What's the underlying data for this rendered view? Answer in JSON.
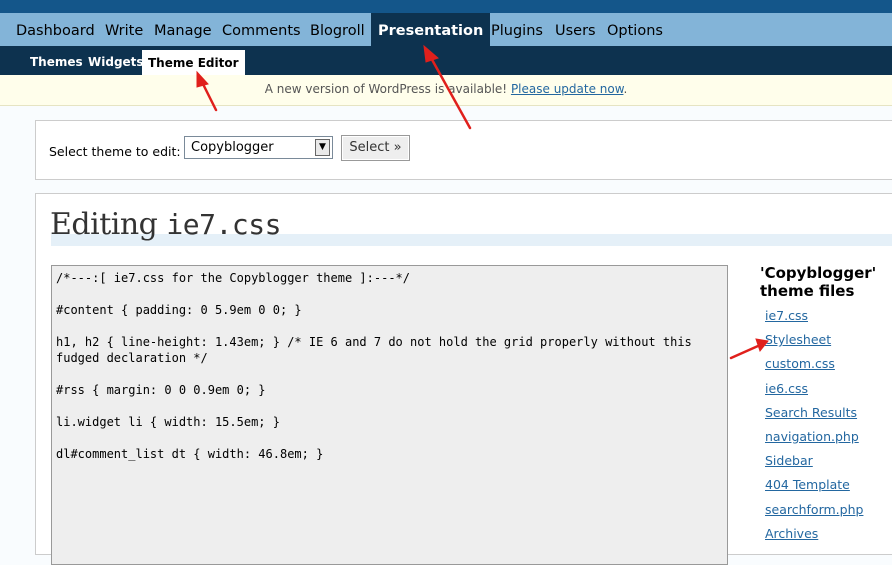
{
  "main_nav": [
    {
      "label": "Dashboard"
    },
    {
      "label": "Write"
    },
    {
      "label": "Manage"
    },
    {
      "label": "Comments"
    },
    {
      "label": "Blogroll"
    },
    {
      "label": "Presentation",
      "active": true
    },
    {
      "label": "Plugins"
    },
    {
      "label": "Users"
    },
    {
      "label": "Options"
    }
  ],
  "sub_nav": [
    {
      "label": "Themes"
    },
    {
      "label": "Widgets"
    },
    {
      "label": "Theme Editor",
      "active": true
    }
  ],
  "notice": {
    "text": "A new version of WordPress is available! ",
    "link": "Please update now",
    "end": "."
  },
  "theme_select": {
    "label": "Select theme to edit:",
    "value": "Copyblogger",
    "button": "Select »"
  },
  "editor": {
    "heading": "Editing",
    "filename": "ie7.css",
    "lines": [
      "/*---:[ ie7.css for the Copyblogger theme ]:---*/",
      "",
      "#content { padding: 0 5.9em 0 0; }",
      "",
      "h1, h2 { line-height: 1.43em; } /* IE 6 and 7 do not hold the grid properly without this fudged declaration */",
      "",
      "#rss { margin: 0 0 0.9em 0; }",
      "",
      "li.widget li { width: 15.5em; }",
      "",
      "dl#comment_list dt { width: 46.8em; }"
    ]
  },
  "theme_files": {
    "title": "'Copyblogger' theme files",
    "files": [
      "ie7.css",
      "Stylesheet",
      "custom.css",
      "ie6.css",
      "Search Results",
      "navigation.php",
      "Sidebar",
      "404 Template",
      "searchform.php",
      "Archives"
    ]
  },
  "colors": {
    "header_dark": "#0d324f",
    "nav_light": "#83b4d8",
    "link": "#2367a0",
    "annotation_arrow": "#e0201c"
  }
}
